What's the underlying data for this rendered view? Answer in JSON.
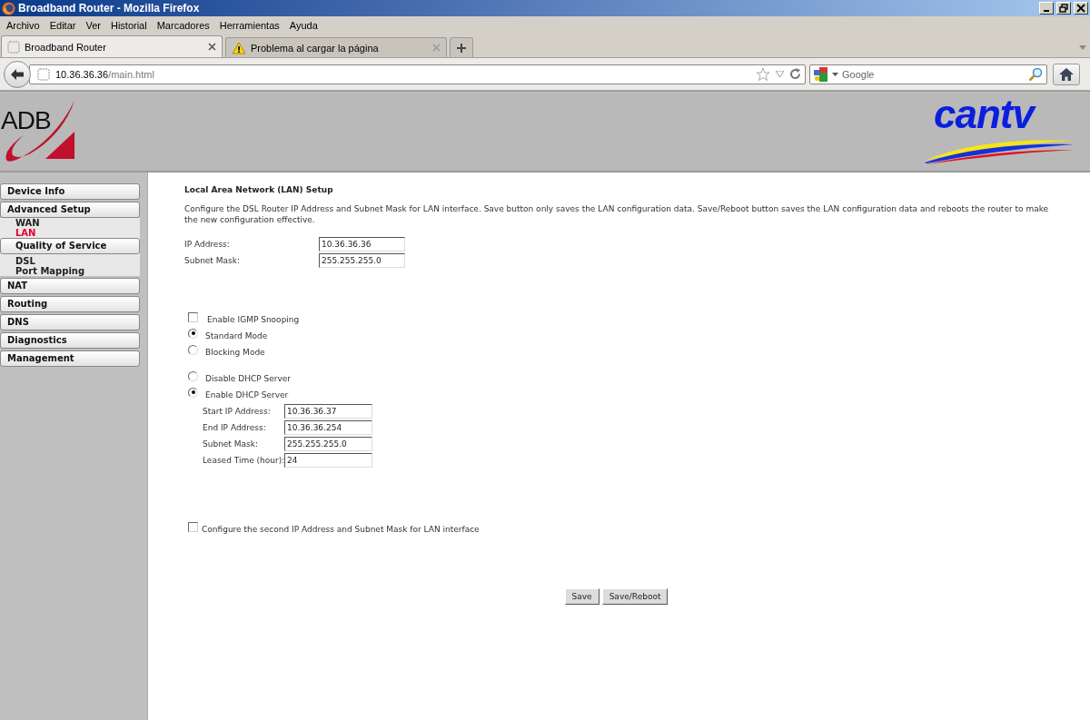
{
  "window": {
    "title": "Broadband Router - Mozilla Firefox"
  },
  "menu_bar": [
    "Archivo",
    "Editar",
    "Ver",
    "Historial",
    "Marcadores",
    "Herramientas",
    "Ayuda"
  ],
  "tabs": [
    {
      "label": "Broadband Router",
      "selected": true,
      "kind": "page"
    },
    {
      "label": "Problema al cargar la página",
      "selected": false,
      "kind": "warning"
    }
  ],
  "address_bar": {
    "host": "10.36.36.36",
    "path": "/main.html"
  },
  "search": {
    "placeholder": "Google"
  },
  "header": {
    "left_logo": "ADB",
    "right_logo": "cantv"
  },
  "sidebar": {
    "items": [
      {
        "label": "Device Info",
        "kind": "button",
        "selected": false
      },
      {
        "label": "Advanced Setup",
        "kind": "button",
        "selected": false,
        "children": [
          {
            "label": "WAN",
            "kind": "link",
            "selected": false
          },
          {
            "label": "LAN",
            "kind": "link",
            "selected": true
          },
          {
            "label": "Quality of Service",
            "kind": "button",
            "selected": false
          },
          {
            "label": "DSL",
            "kind": "link",
            "selected": false
          },
          {
            "label": "Port Mapping",
            "kind": "link",
            "selected": false
          }
        ]
      },
      {
        "label": "NAT",
        "kind": "button",
        "selected": false
      },
      {
        "label": "Routing",
        "kind": "button",
        "selected": false
      },
      {
        "label": "DNS",
        "kind": "button",
        "selected": false
      },
      {
        "label": "Diagnostics",
        "kind": "button",
        "selected": false
      },
      {
        "label": "Management",
        "kind": "button",
        "selected": false
      }
    ]
  },
  "content": {
    "title": "Local Area Network (LAN) Setup",
    "description": "Configure the DSL Router IP Address and Subnet Mask for LAN interface.  Save button only saves the LAN configuration data.  Save/Reboot button saves the LAN configuration data and reboots the router to make the new configuration effective.",
    "ip_fields": [
      {
        "label": "IP Address:",
        "value": "10.36.36.36"
      },
      {
        "label": "Subnet Mask:",
        "value": "255.255.255.0"
      }
    ],
    "igmp": {
      "label": "Enable IGMP Snooping",
      "checked": false
    },
    "igmp_modes": [
      {
        "label": "Standard Mode",
        "selected": true
      },
      {
        "label": "Blocking Mode",
        "selected": false
      }
    ],
    "dhcp_modes": [
      {
        "label": "Disable DHCP Server",
        "selected": false
      },
      {
        "label": "Enable DHCP Server",
        "selected": true
      }
    ],
    "dhcp_fields": [
      {
        "label": "Start IP Address:",
        "value": "10.36.36.37"
      },
      {
        "label": "End IP Address:",
        "value": "10.36.36.254"
      },
      {
        "label": "Subnet Mask:",
        "value": "255.255.255.0"
      },
      {
        "label": "Leased Time (hour):",
        "value": "24"
      }
    ],
    "second_ip": {
      "label": "Configure the second IP Address and Subnet Mask for LAN interface",
      "checked": false
    },
    "buttons": [
      "Save",
      "Save/Reboot"
    ]
  }
}
